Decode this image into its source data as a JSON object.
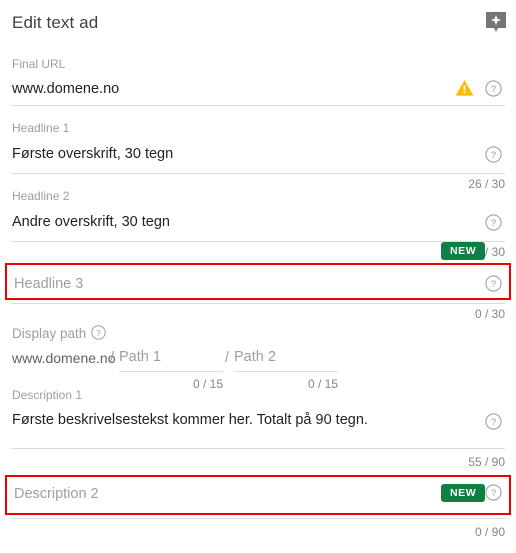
{
  "header": {
    "title": "Edit text ad",
    "sparkle_icon": "sparkle-tooltip-icon"
  },
  "fields": {
    "final_url": {
      "label": "Final URL",
      "value": "www.domene.no",
      "warning_icon": "warning-triangle-icon",
      "help_icon": "help-circle-icon"
    },
    "headline1": {
      "label": "Headline 1",
      "value": "Første overskrift, 30 tegn",
      "counter": "26 / 30",
      "help_icon": "help-circle-icon"
    },
    "headline2": {
      "label": "Headline 2",
      "value": "Andre overskrift, 30 tegn",
      "counter": "25 / 30",
      "help_icon": "help-circle-icon"
    },
    "headline3": {
      "label": "Headline 3",
      "placeholder": "Headline 3",
      "value": "",
      "counter": "0 / 30",
      "badge": "NEW",
      "help_icon": "help-circle-icon",
      "highlighted": true
    },
    "display_path": {
      "label": "Display path",
      "help_icon": "help-circle-icon",
      "domain": "www.domene.no",
      "path1": {
        "slash": "/",
        "placeholder": "Path 1",
        "value": "",
        "counter": "0 / 15"
      },
      "path2": {
        "slash": "/",
        "placeholder": "Path 2",
        "value": "",
        "counter": "0 / 15"
      }
    },
    "description1": {
      "label": "Description 1",
      "value": "Første beskrivelsestekst kommer her. Totalt på 90 tegn.",
      "counter": "55 / 90",
      "help_icon": "help-circle-icon"
    },
    "description2": {
      "label": "Description 2",
      "placeholder": "Description 2",
      "value": "",
      "counter": "0 / 90",
      "badge": "NEW",
      "help_icon": "help-circle-icon",
      "highlighted": true
    }
  },
  "colors": {
    "badge_green": "#0f8043",
    "warning_amber": "#fbbc04",
    "highlight_red": "#ee0000",
    "divider_grey": "#dadce0",
    "label_grey": "#9aa0a6",
    "text_dark": "#202124"
  }
}
